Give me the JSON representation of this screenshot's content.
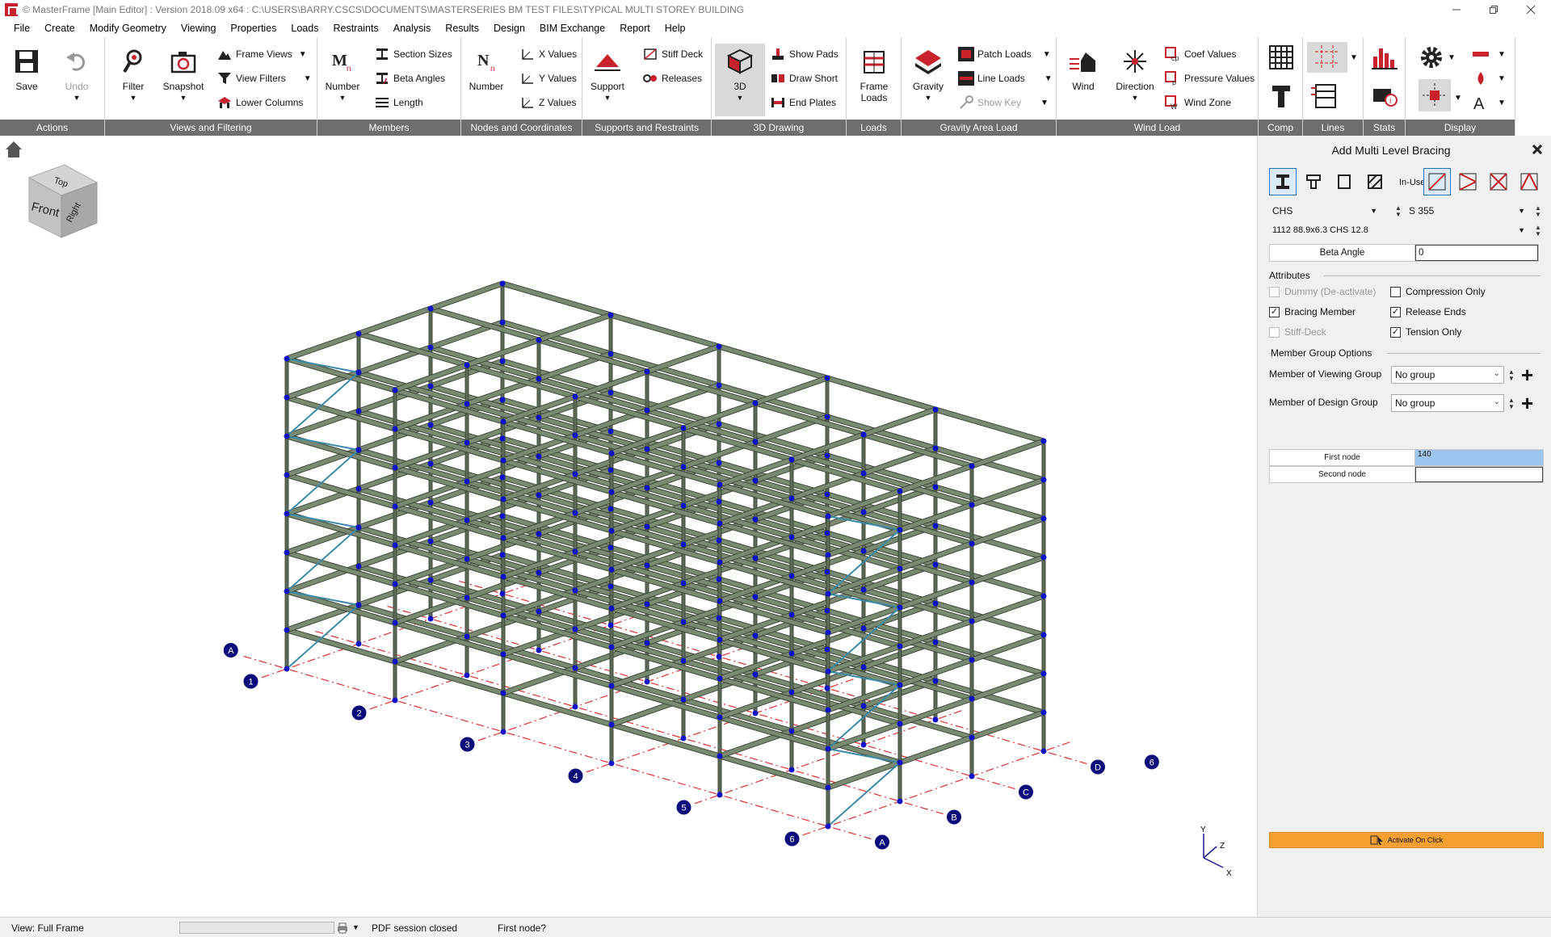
{
  "window": {
    "title": "© MasterFrame [Main Editor] : Version 2018.09 x64 : C:\\USERS\\BARRY.CSCS\\DOCUMENTS\\MASTERSERIES BM TEST FILES\\TYPICAL MULTI STOREY BUILDING",
    "icon": "masterframe-logo"
  },
  "menu": [
    "File",
    "Create",
    "Modify Geometry",
    "Viewing",
    "Properties",
    "Loads",
    "Restraints",
    "Analysis",
    "Results",
    "Design",
    "BIM Exchange",
    "Report",
    "Help"
  ],
  "ribbon": {
    "actions": {
      "label": "Actions",
      "save": "Save",
      "undo": "Undo"
    },
    "views": {
      "label": "Views and Filtering",
      "filter": "Filter",
      "snapshot": "Snapshot",
      "frame_views": "Frame Views",
      "view_filters": "View Filters",
      "lower_columns": "Lower Columns"
    },
    "members": {
      "label": "Members",
      "number": "Number",
      "section_sizes": "Section Sizes",
      "beta_angles": "Beta Angles",
      "length": "Length"
    },
    "nodes": {
      "label": "Nodes and Coordinates",
      "number": "Number",
      "x_values": "X Values",
      "y_values": "Y Values",
      "z_values": "Z Values"
    },
    "supports": {
      "label": "Supports and Restraints",
      "support": "Support",
      "stiff_deck": "Stiff Deck",
      "releases": "Releases"
    },
    "drawing3d": {
      "label": "3D Drawing",
      "btn3d": "3D",
      "show_pads": "Show Pads",
      "draw_short": "Draw Short",
      "end_plates": "End Plates"
    },
    "loads": {
      "label": "Loads",
      "frame_loads_1": "Frame",
      "frame_loads_2": "Loads"
    },
    "gravity": {
      "label": "Gravity Area Load",
      "gravity": "Gravity",
      "patch_loads": "Patch Loads",
      "line_loads": "Line Loads",
      "show_key": "Show Key"
    },
    "wind": {
      "label": "Wind Load",
      "wind": "Wind",
      "direction": "Direction",
      "coef_values": "Coef Values",
      "pressure_values": "Pressure Values",
      "wind_zone": "Wind Zone"
    },
    "comp": {
      "label": "Comp"
    },
    "lines": {
      "label": "Lines"
    },
    "stats": {
      "label": "Stats"
    },
    "display": {
      "label": "Display"
    }
  },
  "panel": {
    "title": "Add Multi Level Bracing",
    "in_use_label": "In-Use",
    "section_type": "CHS",
    "grade": "S 355",
    "section": "1112 88.9x6.3 CHS 12.8",
    "beta_angle_label": "Beta Angle",
    "beta_angle_value": "0",
    "attributes_header": "Attributes",
    "attributes": {
      "dummy": {
        "label": "Dummy (De-activate)",
        "checked": false,
        "enabled": false
      },
      "compression_only": {
        "label": "Compression Only",
        "checked": false,
        "enabled": true
      },
      "bracing_member": {
        "label": "Bracing Member",
        "checked": true,
        "enabled": true
      },
      "release_ends": {
        "label": "Release Ends",
        "checked": true,
        "enabled": true
      },
      "stiff_deck": {
        "label": "Stiff-Deck",
        "checked": false,
        "enabled": false
      },
      "tension_only": {
        "label": "Tension Only",
        "checked": true,
        "enabled": true
      }
    },
    "group_header": "Member Group Options",
    "viewing_group_label": "Member of Viewing Group",
    "viewing_group_value": "No group",
    "design_group_label": "Member of Design Group",
    "design_group_value": "No group",
    "first_node_label": "First node",
    "first_node_value": "140",
    "second_node_label": "Second node",
    "second_node_value": "",
    "activate_button": "Activate On Click"
  },
  "viewcube": {
    "top": "Top",
    "front": "Front",
    "right": "Right"
  },
  "gridlines": {
    "numbers": [
      "1",
      "2",
      "3",
      "4",
      "5",
      "6",
      "6"
    ],
    "letters": [
      "A",
      "A",
      "B",
      "C",
      "D"
    ]
  },
  "axes": {
    "x": "X",
    "y": "Y",
    "z": "Z"
  },
  "status": {
    "view": "View: Full Frame",
    "pdf": "PDF session closed",
    "prompt": "First node?"
  },
  "colors": {
    "ribbon_group_bar": "#6e6e6e",
    "member": "#7a8a72",
    "node": "#1010c8",
    "brace": "#3a8aa8",
    "grid_line": "#e03030",
    "grid_bubble": "#0a0a7a",
    "selected_input": "#9cc4ec",
    "activate_button": "#f5a030"
  }
}
